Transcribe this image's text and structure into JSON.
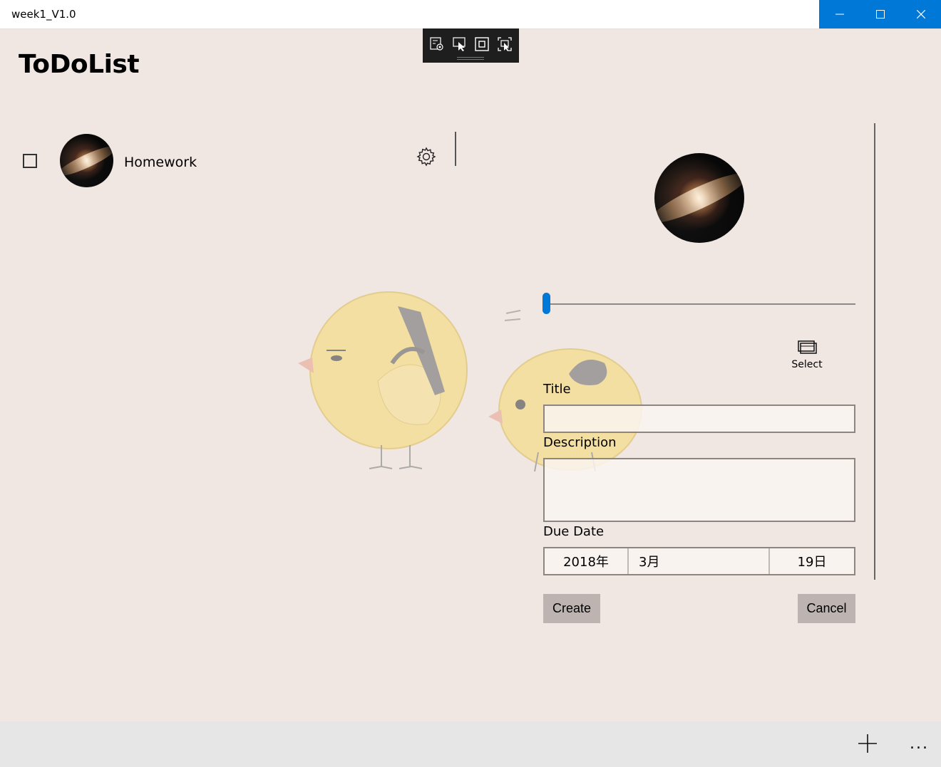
{
  "window": {
    "title": "week1_V1.0",
    "accent_color": "#0078d7",
    "controls": [
      "minimize-icon",
      "maximize-icon",
      "close-icon"
    ]
  },
  "debug_toolbar": {
    "icons": [
      "live-visual-tree-icon",
      "select-element-icon",
      "display-layout-adorners-icon",
      "track-focus-icon"
    ]
  },
  "app": {
    "title": "ToDoList"
  },
  "todo_list": {
    "items": [
      {
        "label": "Homework",
        "checked": false,
        "avatar": "galaxy-image",
        "settings_icon": "gear-icon"
      }
    ]
  },
  "form": {
    "image": "galaxy-image",
    "slider_value": 0,
    "select_button": {
      "label": "Select",
      "icon": "picture-select-icon"
    },
    "title": {
      "label": "Title",
      "value": ""
    },
    "description": {
      "label": "Description",
      "value": ""
    },
    "due_date": {
      "label": "Due Date",
      "year": "2018年",
      "month": "3月",
      "day": "19日"
    },
    "create_label": "Create",
    "cancel_label": "Cancel"
  },
  "app_bar": {
    "add_icon": "plus-icon",
    "more_label": "..."
  }
}
